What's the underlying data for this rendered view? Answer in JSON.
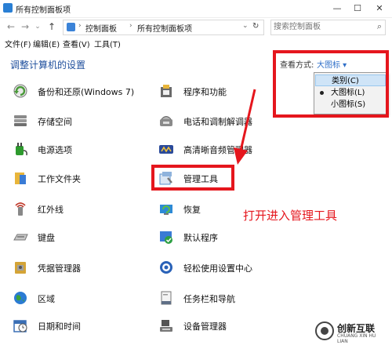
{
  "window": {
    "title": "所有控制面板项",
    "controls": [
      "—",
      "☐",
      "✕"
    ]
  },
  "addressbar": {
    "back": "←",
    "forward": "→",
    "recent": "⌄",
    "up": "↑",
    "crumbs": [
      "控制面板",
      "所有控制面板项"
    ],
    "refresh": "↻",
    "search_placeholder": "搜索控制面板"
  },
  "menubar": [
    "文件(F)",
    "编辑(E)",
    "查看(V)",
    "工具(T)"
  ],
  "heading": "调整计算机的设置",
  "view_by": {
    "label": "查看方式:",
    "value": "大图标 ▾",
    "options": [
      "类别(C)",
      "大图标(L)",
      "小图标(S)"
    ],
    "selected": "大图标(L)",
    "hover": "类别(C)"
  },
  "items_left": [
    {
      "label": "备份和还原(Windows 7)",
      "icon": "backup-restore-icon",
      "color": "#4a9a3a"
    },
    {
      "label": "存储空间",
      "icon": "storage-spaces-icon",
      "color": "#7a7a7a"
    },
    {
      "label": "电源选项",
      "icon": "power-options-icon",
      "color": "#2e9a2e"
    },
    {
      "label": "工作文件夹",
      "icon": "work-folders-icon",
      "color": "#e8b53a"
    },
    {
      "label": "红外线",
      "icon": "infrared-icon",
      "color": "#c0392b"
    },
    {
      "label": "键盘",
      "icon": "keyboard-icon",
      "color": "#8a8a8a"
    },
    {
      "label": "凭据管理器",
      "icon": "credential-manager-icon",
      "color": "#d4a437"
    },
    {
      "label": "区域",
      "icon": "region-icon",
      "color": "#2b7bd3"
    },
    {
      "label": "日期和时间",
      "icon": "date-time-icon",
      "color": "#3a6fb5"
    }
  ],
  "items_right": [
    {
      "label": "程序和功能",
      "icon": "programs-features-icon",
      "color": "#6a6a6a"
    },
    {
      "label": "电话和调制解调器",
      "icon": "phone-modem-icon",
      "color": "#7d7d7d"
    },
    {
      "label": "高清晰音频管理器",
      "icon": "hd-audio-manager-icon",
      "color": "#2a4a9a"
    },
    {
      "label": "管理工具",
      "icon": "administrative-tools-icon",
      "color": "#5a8fc9"
    },
    {
      "label": "恢复",
      "icon": "recovery-icon",
      "color": "#2d8ad6"
    },
    {
      "label": "默认程序",
      "icon": "default-programs-icon",
      "color": "#2ea044"
    },
    {
      "label": "轻松使用设置中心",
      "icon": "ease-of-access-icon",
      "color": "#2a62b8"
    },
    {
      "label": "任务栏和导航",
      "icon": "taskbar-navigation-icon",
      "color": "#5f6f86"
    },
    {
      "label": "设备管理器",
      "icon": "device-manager-icon",
      "color": "#555555"
    }
  ],
  "annotation": "打开进入管理工具",
  "watermark": {
    "title": "创新互联",
    "subtitle": "CHUANG XIN HU LIAN"
  },
  "colors": {
    "highlight": "#e5161d",
    "link": "#1e4e9c"
  }
}
